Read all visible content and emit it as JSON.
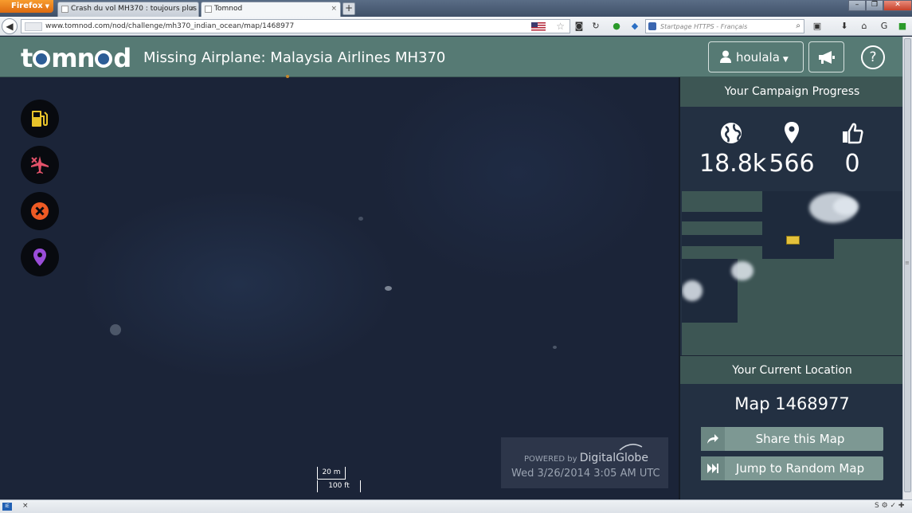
{
  "browser": {
    "menu_label": "Firefox",
    "tabs": [
      {
        "title": "Crash du vol MH370 : toujours plus d...",
        "active": false
      },
      {
        "title": "Tomnod",
        "active": true
      }
    ],
    "url": "www.tomnod.com/nod/challenge/mh370_indian_ocean/map/1468977",
    "search_placeholder": "Startpage HTTPS - Français"
  },
  "header": {
    "logo": "tomnod",
    "title": "Missing Airplane: Malaysia Airlines MH370",
    "username": "houlala",
    "help": "?"
  },
  "tools": [
    {
      "name": "fuel-tool",
      "color": "#e8c32a"
    },
    {
      "name": "wreckage-tool",
      "color": "#e3526a"
    },
    {
      "name": "oil-slick-tool",
      "color": "#ee5a24"
    },
    {
      "name": "other-tool",
      "color": "#9a4dd8"
    }
  ],
  "map": {
    "scale_metric": "20 m",
    "scale_imperial": "100 ft",
    "powered_by": "POWERED by",
    "provider": "DigitalGlobe",
    "capture_date": "Wed 3/26/2014 3:05 AM UTC"
  },
  "sidebar": {
    "campaign_heading": "Your Campaign Progress",
    "stats": [
      {
        "name": "maps-viewed",
        "value": "18.8k"
      },
      {
        "name": "tags-placed",
        "value": "566"
      },
      {
        "name": "agreements",
        "value": "0"
      }
    ],
    "location_heading": "Your Current Location",
    "map_id": "Map 1468977",
    "share_label": "Share this Map",
    "random_label": "Jump to Random Map"
  }
}
